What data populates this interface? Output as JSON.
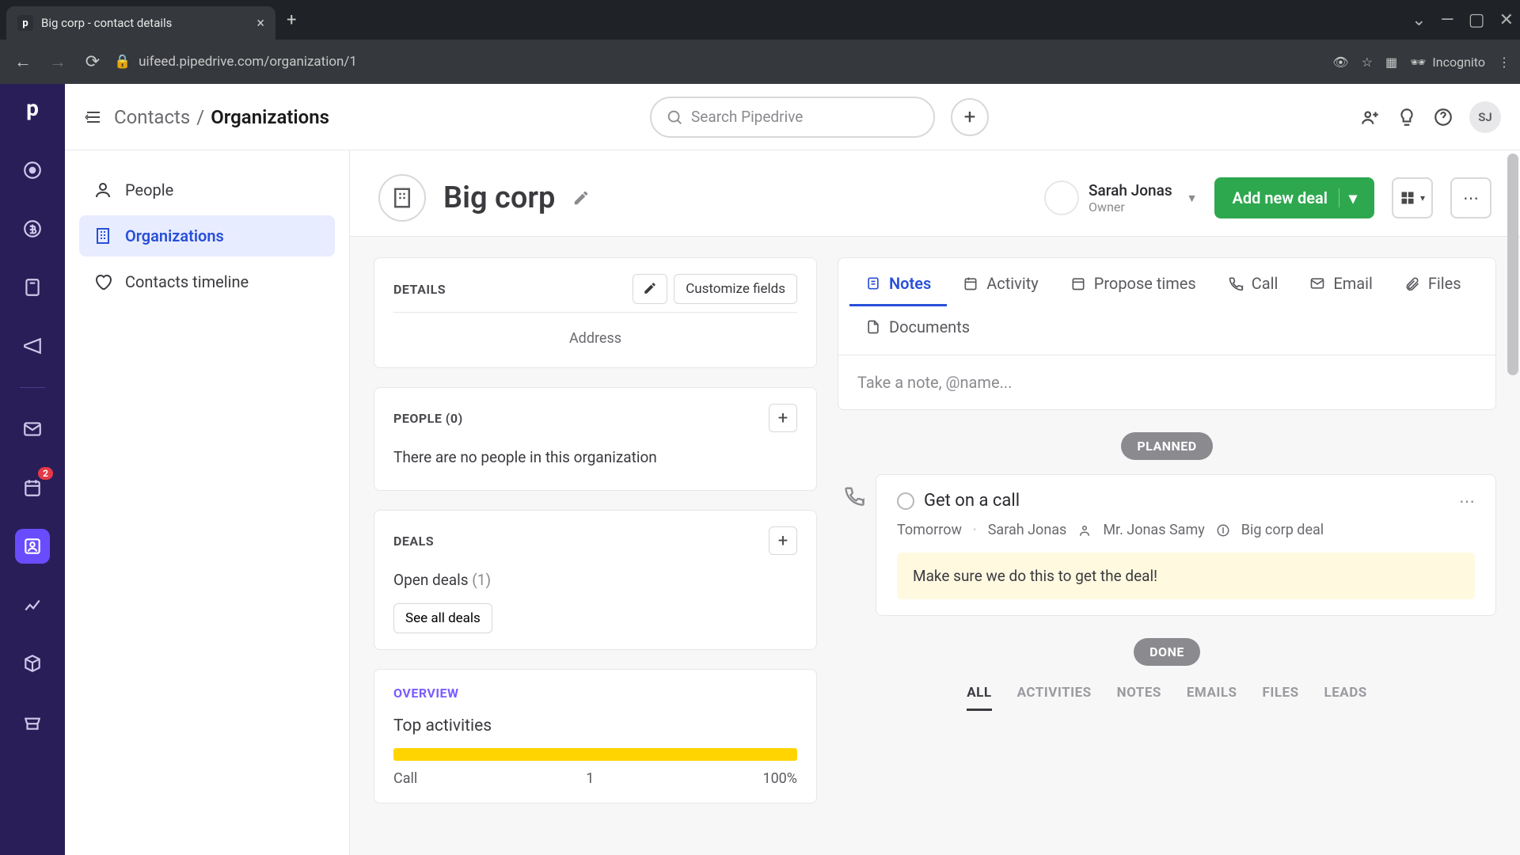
{
  "browser": {
    "tab_title": "Big corp - contact details",
    "url": "uifeed.pipedrive.com/organization/1",
    "incognito": "Incognito"
  },
  "topbar": {
    "breadcrumb_root": "Contacts",
    "breadcrumb_current": "Organizations",
    "search_placeholder": "Search Pipedrive",
    "avatar_initials": "SJ"
  },
  "sidebar": {
    "items": [
      {
        "label": "People"
      },
      {
        "label": "Organizations"
      },
      {
        "label": "Contacts timeline"
      }
    ]
  },
  "org": {
    "name": "Big corp",
    "owner_name": "Sarah Jonas",
    "owner_role": "Owner",
    "add_deal": "Add new deal"
  },
  "details": {
    "title": "DETAILS",
    "customize": "Customize fields",
    "address_label": "Address"
  },
  "people": {
    "title": "PEOPLE (0)",
    "empty": "There are no people in this organization"
  },
  "deals": {
    "title": "DEALS",
    "open_label": "Open deals ",
    "open_count": "(1)",
    "see_all": "See all deals"
  },
  "overview": {
    "title": "OVERVIEW",
    "top_activities": "Top activities",
    "call_label": "Call",
    "call_count": "1",
    "call_pct": "100%"
  },
  "tabs": {
    "notes": "Notes",
    "activity": "Activity",
    "propose": "Propose times",
    "call": "Call",
    "email": "Email",
    "files": "Files",
    "documents": "Documents"
  },
  "note_placeholder": "Take a note, @name...",
  "planned_label": "PLANNED",
  "done_label": "DONE",
  "activity": {
    "title": "Get on a call",
    "when": "Tomorrow",
    "who": "Sarah Jonas",
    "person": "Mr. Jonas Samy",
    "deal": "Big corp deal",
    "note": "Make sure we do this to get the deal!"
  },
  "filter_tabs": {
    "all": "ALL",
    "activities": "ACTIVITIES",
    "notes": "NOTES",
    "emails": "EMAILS",
    "files": "FILES",
    "leads": "LEADS"
  },
  "rail_badge": "2"
}
